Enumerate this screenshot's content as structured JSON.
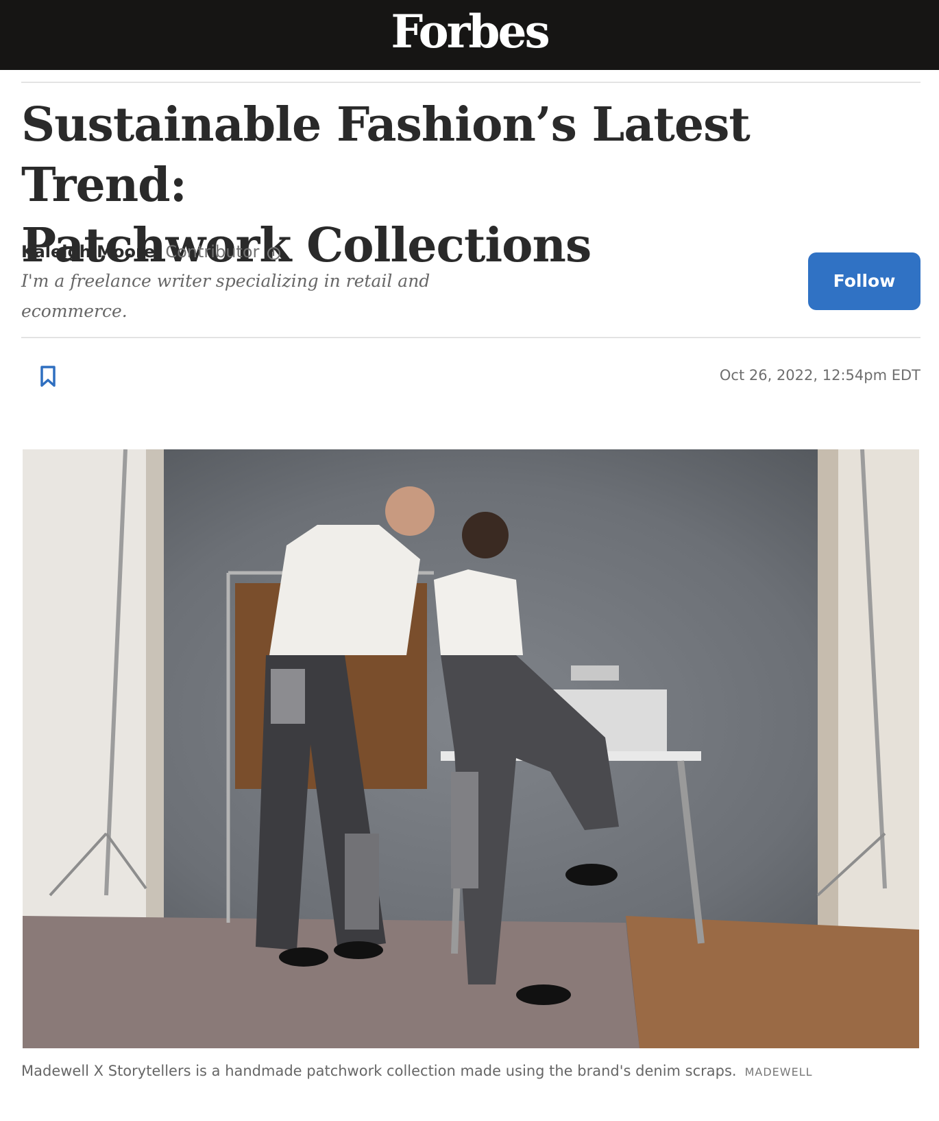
{
  "header": {
    "logo": "Forbes"
  },
  "article": {
    "headline_line1": "Sustainable Fashion’s Latest Trend:",
    "headline_line2": "Patchwork Collections",
    "author": "Kaleigh Moore",
    "author_role": "Contributor",
    "author_bio_line1": "I'm a freelance writer specializing in retail and",
    "author_bio_line2": "ecommerce.",
    "follow_label": "Follow",
    "date": "Oct 26, 2022, 12:54pm EDT"
  },
  "image": {
    "caption": "Madewell X Storytellers is a handmade patchwork collection made using the brand's denim scraps.",
    "credit": "MADEWELL"
  },
  "colors": {
    "topbar": "#161514",
    "accent_blue": "#3072c4",
    "bookmark": "#2f6fc0"
  },
  "icons": {
    "info": "info-circle-icon",
    "bookmark": "bookmark-icon"
  }
}
